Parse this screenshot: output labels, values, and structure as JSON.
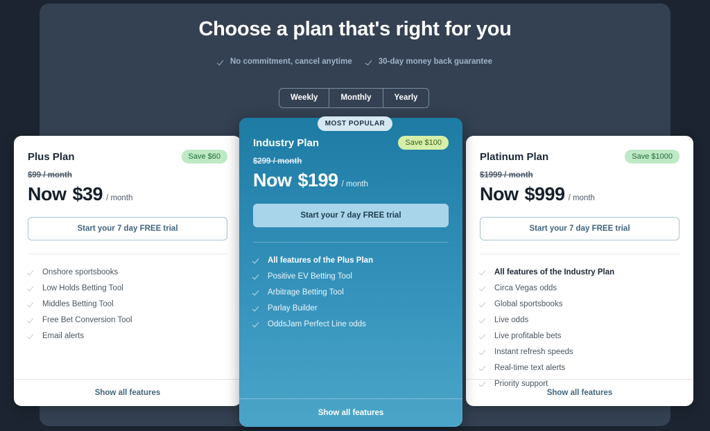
{
  "header": {
    "title": "Choose a plan that's right for you",
    "subpoints": [
      {
        "icon": "check-icon",
        "label": "No commitment, cancel anytime"
      },
      {
        "icon": "check-icon",
        "label": "30-day money back guarantee"
      }
    ]
  },
  "billing_toggle": {
    "options": [
      "Weekly",
      "Monthly",
      "Yearly"
    ],
    "selected": "Monthly"
  },
  "most_popular_label": "MOST POPULAR",
  "plans": {
    "plus": {
      "name": "Plus Plan",
      "save_badge": "Save $60",
      "old_price": "$99 / month",
      "now_label": "Now",
      "price": "$39",
      "per": "/ month",
      "cta": "Start your 7 day FREE trial",
      "features": [
        "Onshore sportsbooks",
        "Low Holds Betting Tool",
        "Middles Betting Tool",
        "Free Bet Conversion Tool",
        "Email alerts"
      ],
      "footer_link": "Show all features"
    },
    "industry": {
      "name": "Industry Plan",
      "save_badge": "Save $100",
      "old_price": "$299 / month",
      "now_label": "Now",
      "price": "$199",
      "per": "/ month",
      "cta": "Start your 7 day FREE trial",
      "features": [
        "All features of the Plus Plan",
        "Positive EV Betting Tool",
        "Arbitrage Betting Tool",
        "Parlay Builder",
        "OddsJam Perfect Line odds"
      ],
      "footer_link": "Show all features"
    },
    "platinum": {
      "name": "Platinum Plan",
      "save_badge": "Save $1000",
      "old_price": "$1999 / month",
      "now_label": "Now",
      "price": "$999",
      "per": "/ month",
      "cta": "Start your 7 day FREE trial",
      "features": [
        "All features of the Industry Plan",
        "Circa Vegas odds",
        "Global sportsbooks",
        "Live odds",
        "Live profitable bets",
        "Instant refresh speeds",
        "Real-time text alerts",
        "Priority support"
      ],
      "footer_link": "Show all features"
    }
  },
  "colors": {
    "page_background": "#1b2430",
    "panel_background": "#344152",
    "highlight_card_top": "#1d7ba4",
    "highlight_card_bottom": "#4ba5c8",
    "save_badge_green": "#bde9c4",
    "save_badge_lime": "#d6efa8",
    "cta_link": "#3f677f"
  }
}
